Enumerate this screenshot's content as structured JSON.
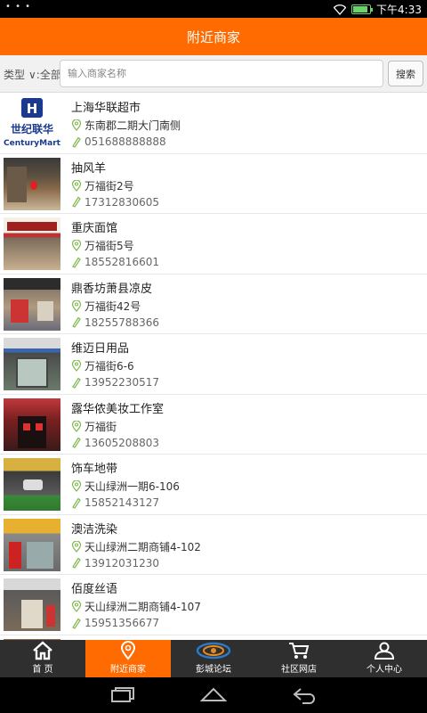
{
  "status_bar": {
    "dots": "• • •",
    "time": "下午4:33",
    "battery_level": 0.9
  },
  "header": {
    "title": "附近商家"
  },
  "search": {
    "type_label": "类型",
    "type_value": "∨:全部",
    "placeholder": "输入商家名称",
    "button_label": "搜索"
  },
  "merchants": [
    {
      "name": "上海华联超市",
      "address": "东南郡二期大门南侧",
      "phone": "051688888888"
    },
    {
      "name": "抽风羊",
      "address": "万福街2号",
      "phone": "17312830605"
    },
    {
      "name": "重庆面馆",
      "address": "万福街5号",
      "phone": "18552816601"
    },
    {
      "name": "鼎香坊萧县凉皮",
      "address": "万福街42号",
      "phone": "18255788366"
    },
    {
      "name": "维迈日用品",
      "address": "万福街6-6",
      "phone": "13952230517"
    },
    {
      "name": "露华侬美妆工作室",
      "address": "万福街",
      "phone": "13605208803"
    },
    {
      "name": "饰车地带",
      "address": "天山绿洲一期6-106",
      "phone": "15852143127"
    },
    {
      "name": "澳洁洗染",
      "address": "天山绿洲二期商铺4-102",
      "phone": "13912031230"
    },
    {
      "name": "佰度丝语",
      "address": "天山绿洲二期商铺4-107",
      "phone": "15951356677"
    }
  ],
  "logo": {
    "chinese": "世纪联华",
    "english": "CenturyMart"
  },
  "bottom_nav": [
    {
      "label": "首  页",
      "icon": "home-icon"
    },
    {
      "label": "附近商家",
      "icon": "location-icon"
    },
    {
      "label": "彭城论坛",
      "icon": "forum-logo-icon"
    },
    {
      "label": "社区网店",
      "icon": "cart-icon"
    },
    {
      "label": "个人中心",
      "icon": "user-icon"
    }
  ],
  "colors": {
    "accent": "#ff6b00",
    "nav_bg": "#2f2f2f",
    "icon_green": "#7cb84a"
  }
}
